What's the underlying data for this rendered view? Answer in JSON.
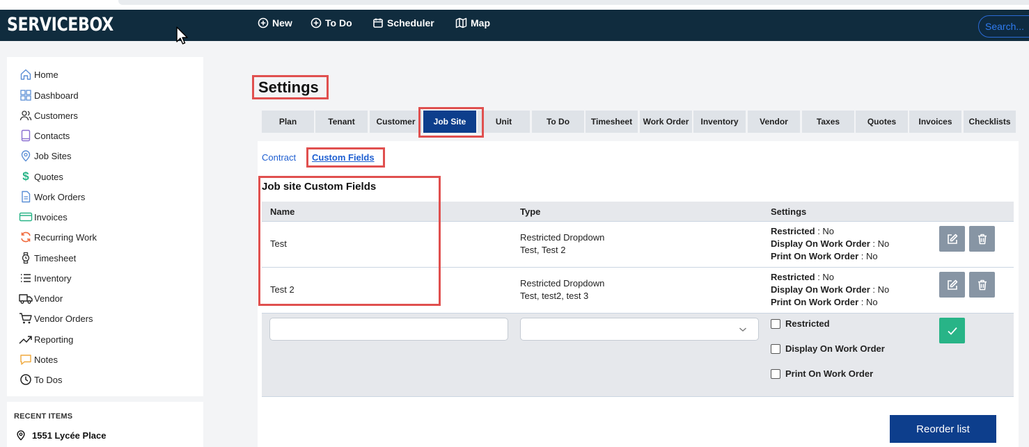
{
  "app": {
    "logo": "SERVICEBOX",
    "search_placeholder": "Search..."
  },
  "topnav": [
    {
      "label": "New",
      "icon": "plus-circle-icon"
    },
    {
      "label": "To Do",
      "icon": "plus-circle-icon"
    },
    {
      "label": "Scheduler",
      "icon": "calendar-icon"
    },
    {
      "label": "Map",
      "icon": "map-icon"
    }
  ],
  "sidebar": {
    "items": [
      {
        "label": "Home",
        "icon": "home-icon"
      },
      {
        "label": "Dashboard",
        "icon": "dashboard-icon"
      },
      {
        "label": "Customers",
        "icon": "users-icon"
      },
      {
        "label": "Contacts",
        "icon": "book-icon"
      },
      {
        "label": "Job Sites",
        "icon": "location-pin-icon"
      },
      {
        "label": "Quotes",
        "icon": "dollar-icon"
      },
      {
        "label": "Work Orders",
        "icon": "document-icon"
      },
      {
        "label": "Invoices",
        "icon": "credit-card-icon"
      },
      {
        "label": "Recurring Work",
        "icon": "refresh-icon"
      },
      {
        "label": "Timesheet",
        "icon": "watch-icon"
      },
      {
        "label": "Inventory",
        "icon": "list-icon"
      },
      {
        "label": "Vendor",
        "icon": "truck-icon"
      },
      {
        "label": "Vendor Orders",
        "icon": "cart-icon"
      },
      {
        "label": "Reporting",
        "icon": "trend-up-icon"
      },
      {
        "label": "Notes",
        "icon": "note-icon"
      },
      {
        "label": "To Dos",
        "icon": "clock-icon"
      }
    ],
    "recent_title": "RECENT ITEMS",
    "recent_items": [
      {
        "label": "1551 Lycée Place",
        "icon": "location-pin-icon"
      }
    ]
  },
  "page": {
    "title": "Settings"
  },
  "tabs": [
    {
      "label": "Plan"
    },
    {
      "label": "Tenant"
    },
    {
      "label": "Customer"
    },
    {
      "label": "Job Site"
    },
    {
      "label": "Unit"
    },
    {
      "label": "To Do"
    },
    {
      "label": "Timesheet"
    },
    {
      "label": "Work Order"
    },
    {
      "label": "Inventory"
    },
    {
      "label": "Vendor"
    },
    {
      "label": "Taxes"
    },
    {
      "label": "Quotes"
    },
    {
      "label": "Invoices"
    },
    {
      "label": "Checklists"
    }
  ],
  "active_tab": "Job Site",
  "subtabs": [
    {
      "label": "Contract"
    },
    {
      "label": "Custom Fields"
    }
  ],
  "active_subtab": "Custom Fields",
  "section_title": "Job site Custom Fields",
  "table": {
    "headers": {
      "name": "Name",
      "type": "Type",
      "settings": "Settings"
    },
    "rows": [
      {
        "name": "Test",
        "type": "Restricted Dropdown",
        "options": "Test, Test 2",
        "restricted_label": "Restricted",
        "restricted": "No",
        "display_label": "Display On Work Order",
        "display": "No",
        "print_label": "Print On Work Order",
        "print": "No"
      },
      {
        "name": "Test 2",
        "type": "Restricted Dropdown",
        "options": "Test, test2, test 3",
        "restricted_label": "Restricted",
        "restricted": "No",
        "display_label": "Display On Work Order",
        "display": "No",
        "print_label": "Print On Work Order",
        "print": "No"
      }
    ],
    "sep": " : "
  },
  "new_row": {
    "name_value": "",
    "type_value": "",
    "checks": [
      {
        "label": "Restricted"
      },
      {
        "label": "Display On Work Order"
      },
      {
        "label": "Print On Work Order"
      }
    ]
  },
  "reorder_label": "Reorder list",
  "colors": {
    "nav": "#102c3e",
    "accent": "#0d3e8c",
    "highlight": "#e0504f",
    "confirm": "#28b487",
    "icon_btn": "#8795a4"
  }
}
